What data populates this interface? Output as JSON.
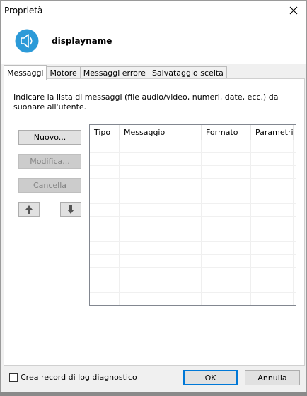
{
  "window": {
    "title": "Proprietà",
    "close_glyph": "✕"
  },
  "header": {
    "name": "displayname",
    "icon": "speaker-icon",
    "icon_color": "#2c9ad8"
  },
  "tabs": [
    {
      "label": "Messaggi",
      "active": true
    },
    {
      "label": "Motore",
      "active": false
    },
    {
      "label": "Messaggi errore",
      "active": false
    },
    {
      "label": "Salvataggio scelta",
      "active": false
    }
  ],
  "panel": {
    "instructions": "Indicare la lista di messaggi (file audio/video, numeri, date, ecc.) da suonare all'utente.",
    "buttons": {
      "new": "Nuovo...",
      "modify": "Modifica...",
      "delete": "Cancella"
    },
    "move_up_icon": "arrow-up-icon",
    "move_down_icon": "arrow-down-icon",
    "table": {
      "columns": [
        "Tipo",
        "Messaggio",
        "Formato",
        "Parametri"
      ],
      "rows": []
    }
  },
  "footer": {
    "log_checkbox_label": "Crea record di log diagnostico",
    "log_checked": false,
    "ok": "OK",
    "cancel": "Annulla"
  }
}
